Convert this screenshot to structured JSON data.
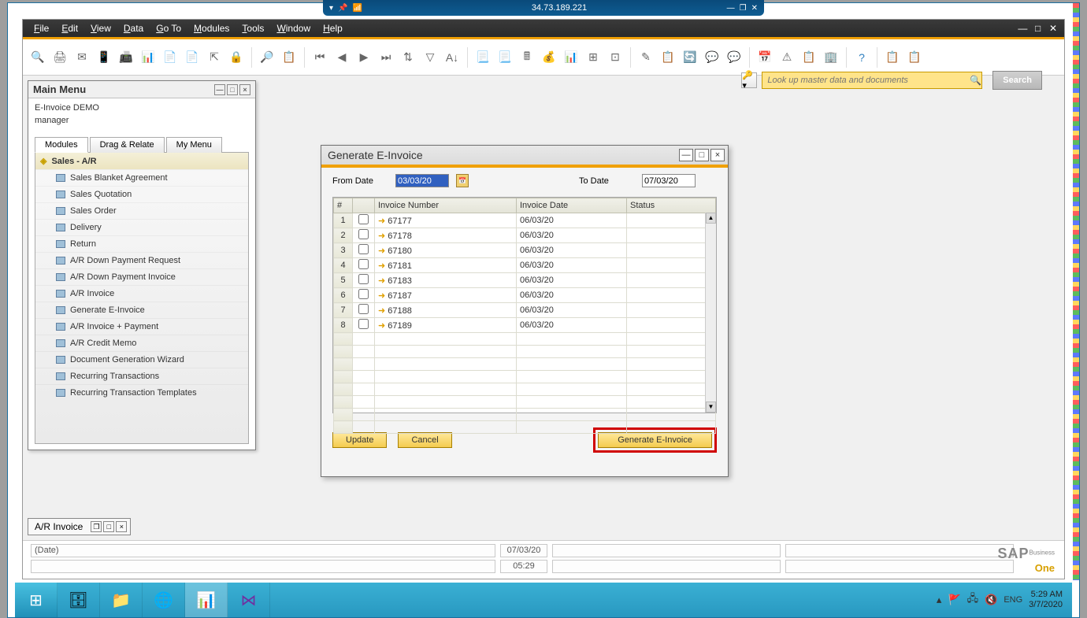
{
  "rdp": {
    "ip": "34.73.189.221"
  },
  "menubar": {
    "file": "File",
    "edit": "Edit",
    "view": "View",
    "data": "Data",
    "goto": "Go To",
    "modules": "Modules",
    "tools": "Tools",
    "window": "Window",
    "help": "Help"
  },
  "search": {
    "placeholder": "Look up master data and documents",
    "button": "Search"
  },
  "mainmenu": {
    "title": "Main Menu",
    "company": "E-Invoice DEMO",
    "user": "manager",
    "tabs": {
      "modules": "Modules",
      "drag": "Drag & Relate",
      "mymenu": "My Menu"
    },
    "section": "Sales - A/R",
    "items": [
      "Sales Blanket Agreement",
      "Sales Quotation",
      "Sales Order",
      "Delivery",
      "Return",
      "A/R Down Payment Request",
      "A/R Down Payment Invoice",
      "A/R Invoice",
      "Generate E-Invoice",
      "A/R Invoice + Payment",
      "A/R Credit Memo",
      "Document Generation Wizard",
      "Recurring Transactions",
      "Recurring Transaction Templates"
    ]
  },
  "einvoice": {
    "title": "Generate E-Invoice",
    "from_label": "From Date",
    "to_label": "To Date",
    "from_value": "03/03/20",
    "to_value": "07/03/20",
    "headers": {
      "num": "#",
      "inv": "Invoice Number",
      "date": "Invoice Date",
      "status": "Status"
    },
    "rows": [
      {
        "n": "1",
        "inv": "67177",
        "date": "06/03/20"
      },
      {
        "n": "2",
        "inv": "67178",
        "date": "06/03/20"
      },
      {
        "n": "3",
        "inv": "67180",
        "date": "06/03/20"
      },
      {
        "n": "4",
        "inv": "67181",
        "date": "06/03/20"
      },
      {
        "n": "5",
        "inv": "67183",
        "date": "06/03/20"
      },
      {
        "n": "6",
        "inv": "67187",
        "date": "06/03/20"
      },
      {
        "n": "7",
        "inv": "67188",
        "date": "06/03/20"
      },
      {
        "n": "8",
        "inv": "67189",
        "date": "06/03/20"
      }
    ],
    "buttons": {
      "update": "Update",
      "cancel": "Cancel",
      "generate": "Generate E-Invoice"
    }
  },
  "minimized": {
    "title": "A/R Invoice"
  },
  "statusbar": {
    "date_label": "(Date)",
    "date_value": "07/03/20",
    "time_value": "05:29"
  },
  "taskbar": {
    "lang": "ENG",
    "time": "5:29 AM",
    "date": "3/7/2020"
  }
}
